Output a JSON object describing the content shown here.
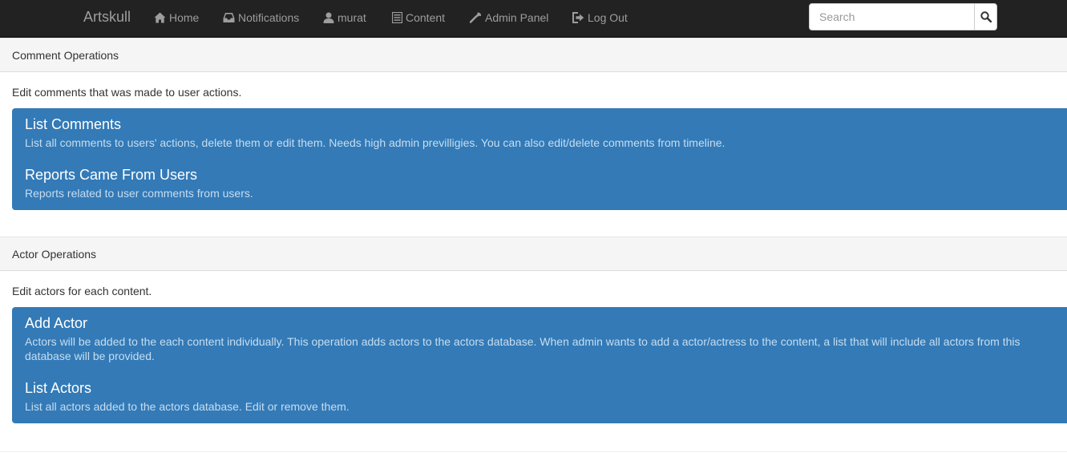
{
  "navbar": {
    "brand": "Artskull",
    "items": [
      {
        "label": "Home",
        "icon": "home-icon"
      },
      {
        "label": "Notifications",
        "icon": "inbox-icon"
      },
      {
        "label": "murat",
        "icon": "user-icon"
      },
      {
        "label": "Content",
        "icon": "list-icon"
      },
      {
        "label": "Admin Panel",
        "icon": "wrench-icon"
      },
      {
        "label": "Log Out",
        "icon": "logout-icon"
      }
    ],
    "search": {
      "placeholder": "Search",
      "value": "",
      "button_icon": "search-icon"
    }
  },
  "sections": [
    {
      "heading": "Comment Operations",
      "description": "Edit comments that was made to user actions.",
      "items": [
        {
          "title": "List Comments",
          "text": "List all comments to users' actions, delete them or edit them. Needs high admin previlligies. You can also edit/delete comments from timeline."
        },
        {
          "title": "Reports Came From Users",
          "text": "Reports related to user comments from users."
        }
      ]
    },
    {
      "heading": "Actor Operations",
      "description": "Edit actors for each content.",
      "items": [
        {
          "title": "Add Actor",
          "text": "Actors will be added to the each content individually. This operation adds actors to the actors database. When admin wants to add a actor/actress to the content, a list that will include all actors from this database will be provided."
        },
        {
          "title": "List Actors",
          "text": "List all actors added to the actors database. Edit or remove them."
        }
      ]
    }
  ],
  "colors": {
    "navbar_bg": "#222222",
    "nav_text": "#9d9d9d",
    "list_group_bg": "#337ab7",
    "item_text": "#c7ddef",
    "panel_heading_bg": "#f5f5f5"
  }
}
